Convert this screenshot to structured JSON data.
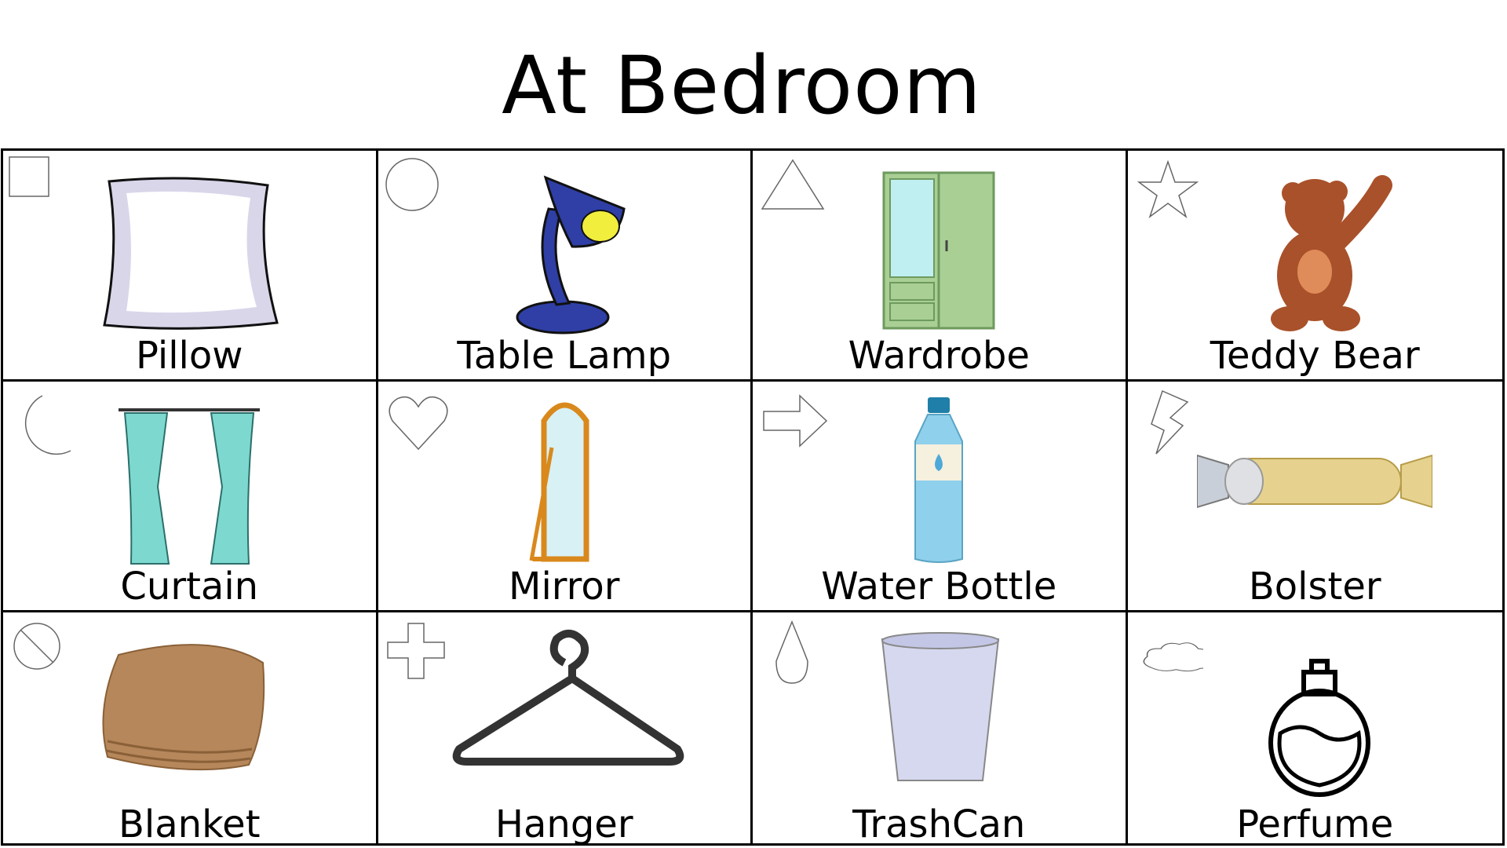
{
  "title": "At Bedroom",
  "cards": [
    {
      "label": "Pillow",
      "symbol": "square-icon",
      "picture": "pillow-icon"
    },
    {
      "label": "Table Lamp",
      "symbol": "circle-icon",
      "picture": "table-lamp-icon"
    },
    {
      "label": "Wardrobe",
      "symbol": "triangle-icon",
      "picture": "wardrobe-icon"
    },
    {
      "label": "Teddy Bear",
      "symbol": "star-icon",
      "picture": "teddy-bear-icon"
    },
    {
      "label": "Curtain",
      "symbol": "crescent-moon-icon",
      "picture": "curtain-icon"
    },
    {
      "label": "Mirror",
      "symbol": "heart-icon",
      "picture": "mirror-icon"
    },
    {
      "label": "Water Bottle",
      "symbol": "arrow-right-icon",
      "picture": "water-bottle-icon"
    },
    {
      "label": "Bolster",
      "symbol": "lightning-icon",
      "picture": "bolster-icon"
    },
    {
      "label": "Blanket",
      "symbol": "prohibited-icon",
      "picture": "blanket-icon"
    },
    {
      "label": "Hanger",
      "symbol": "plus-icon",
      "picture": "hanger-icon"
    },
    {
      "label": "TrashCan",
      "symbol": "droplet-icon",
      "picture": "trash-can-icon"
    },
    {
      "label": "Perfume",
      "symbol": "cloud-icon",
      "picture": "perfume-icon"
    }
  ],
  "colors": {
    "lamp_blue": "#2f3fa6",
    "wardrobe_green": "#a9cf95",
    "bear_brown": "#a9512a",
    "curtain_teal": "#7dd9d0",
    "mirror_frame": "#d9891c",
    "bottle_blue": "#8fd0ec",
    "bolster_yellow": "#e6d28e",
    "blanket_brown": "#b6875a",
    "hanger_gray": "#333333",
    "trash_lilac": "#d6d8ef"
  }
}
